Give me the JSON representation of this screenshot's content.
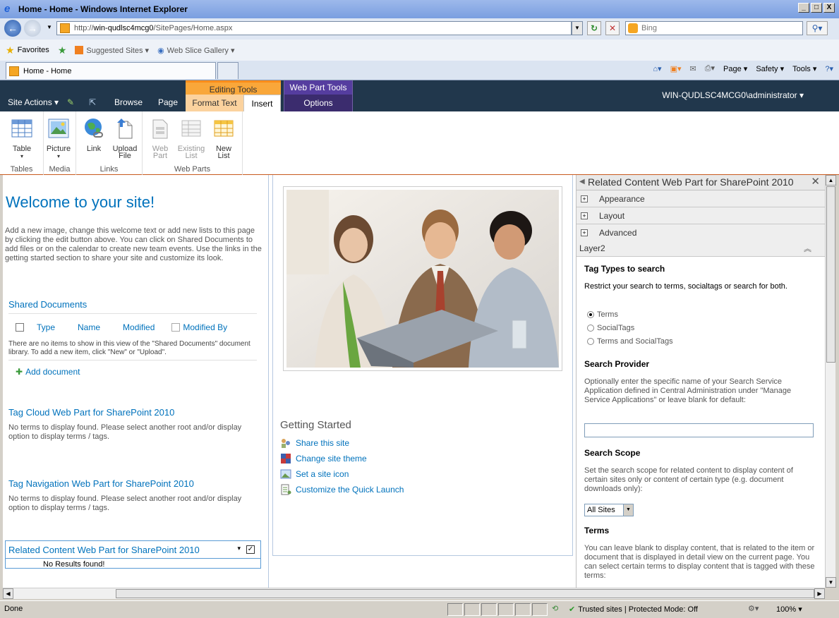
{
  "window": {
    "title": "Home - Home - Windows Internet Explorer",
    "buttons": [
      "_",
      "□",
      "X"
    ]
  },
  "address": {
    "url_prefix": "http://",
    "url_domain": "win-qudlsc4mcg0",
    "url_path": "/SitePages/Home.aspx",
    "search_placeholder": "Bing"
  },
  "favorites": {
    "label": "Favorites",
    "items": [
      "Suggested Sites ▾",
      "Web Slice Gallery ▾"
    ]
  },
  "tabs": {
    "active": "Home - Home"
  },
  "commands": [
    "Page ▾",
    "Safety ▾",
    "Tools ▾"
  ],
  "sp": {
    "site_actions": "Site Actions ▾",
    "browse": "Browse",
    "page": "Page",
    "editing_tools": "Editing Tools",
    "format_text": "Format Text",
    "insert": "Insert",
    "web_part_tools": "Web Part Tools",
    "options": "Options",
    "user": "WIN-QUDLSC4MCG0\\administrator ▾"
  },
  "ribbon": {
    "groups": [
      {
        "label": "Tables",
        "buttons": [
          {
            "label": "Table",
            "sub": "▾"
          }
        ]
      },
      {
        "label": "Media",
        "buttons": [
          {
            "label": "Picture",
            "sub": "▾"
          }
        ]
      },
      {
        "label": "Links",
        "buttons": [
          {
            "label": "Link",
            "sub": ""
          },
          {
            "label": "Upload",
            "sub": "File"
          }
        ]
      },
      {
        "label": "Web Parts",
        "buttons": [
          {
            "label": "Web",
            "sub": "Part"
          },
          {
            "label": "Existing",
            "sub": "List"
          },
          {
            "label": "New",
            "sub": "List"
          }
        ]
      }
    ]
  },
  "left": {
    "welcome_title": "Welcome to your site!",
    "welcome_text": "Add a new image, change this welcome text or add new lists to this page by clicking the edit button above. You can click on Shared Documents to add files or on the calendar to create new team events. Use the links in the getting started section to share your site and customize its look.",
    "shared_docs": "Shared Documents",
    "columns": [
      "Type",
      "Name",
      "Modified",
      "Modified By"
    ],
    "empty_msg": "There are no items to show in this view of the \"Shared Documents\" document library. To add a new item, click \"New\" or \"Upload\".",
    "add_document": "Add document",
    "tag_cloud_title": "Tag Cloud Web Part for SharePoint 2010",
    "tag_cloud_msg": "No terms to display found. Please select another root and/or display option to display terms / tags.",
    "tag_nav_title": "Tag Navigation Web Part for SharePoint 2010",
    "tag_nav_msg": "No terms to display found. Please select another root and/or display option to display terms / tags.",
    "related_title": "Related Content Web Part for SharePoint 2010",
    "related_caret": "▾",
    "check_mark": "✓",
    "no_results": "No Results found!"
  },
  "middle": {
    "getting_started": "Getting Started",
    "links": [
      "Share this site",
      "Change site theme",
      "Set a site icon",
      "Customize the Quick Launch"
    ]
  },
  "panel": {
    "title": "Related Content Web Part for SharePoint 2010",
    "close": "✕",
    "sections": [
      "Appearance",
      "Layout",
      "Advanced"
    ],
    "layer": "Layer2",
    "tag_types_label": "Tag Types to search",
    "tag_types_desc": "Restrict your search to terms, socialtags or search for both.",
    "tag_options": [
      "Terms",
      "SocialTags",
      "Terms and SocialTags"
    ],
    "provider_label": "Search Provider",
    "provider_desc": "Optionally enter the specific name of your Search Service Application defined in Central Administration under \"Manage Service Applications\" or leave blank for default:",
    "scope_label": "Search Scope",
    "scope_desc": "Set the search scope for related content to display content of certain sites only or content of certain type (e.g. document downloads only):",
    "scope_value": "All Sites",
    "terms_label": "Terms",
    "terms_desc": "You can leave blank to display content, that is related to the item or document that is displayed in detail view on the current page. You can select certain terms to display content that is tagged with these terms:"
  },
  "status": {
    "left": "Done",
    "zone": "Trusted sites | Protected Mode: Off",
    "zoom": "100% ▾"
  }
}
